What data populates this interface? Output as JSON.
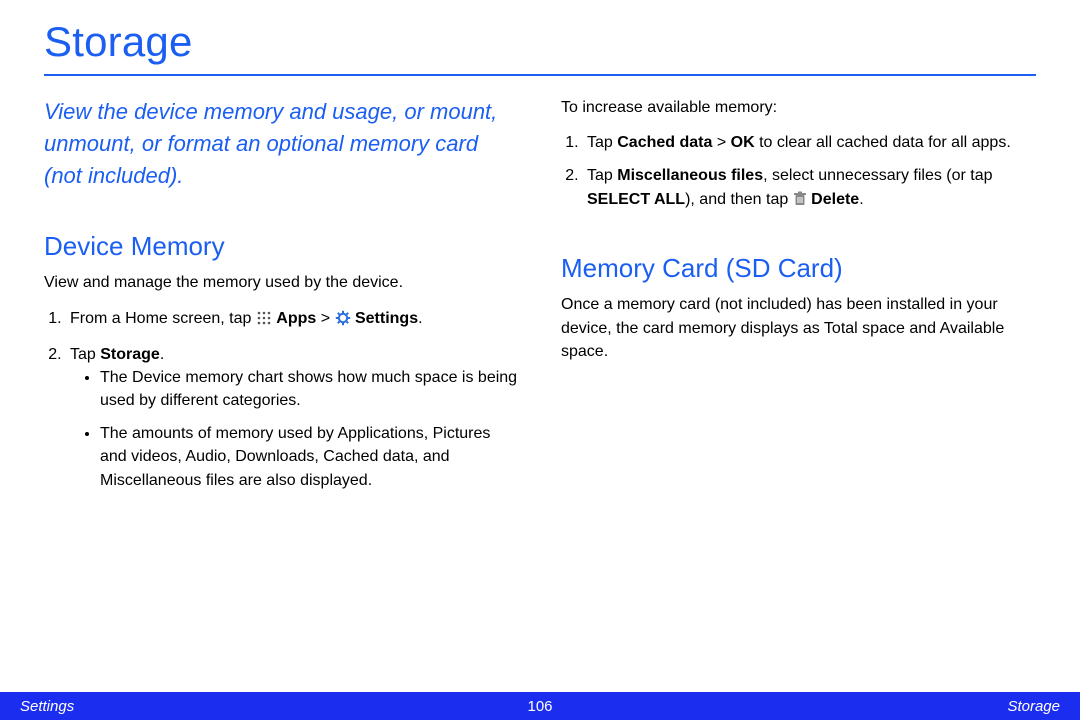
{
  "title": "Storage",
  "intro": "View the device memory and usage, or mount, unmount, or format an optional memory card (not included).",
  "left": {
    "heading": "Device Memory",
    "desc": "View and manage the memory used by the device.",
    "step1_a": "From a Home screen, tap ",
    "step1_apps": "Apps",
    "step1_gt": " > ",
    "step1_settings": " Settings",
    "step1_dot": ".",
    "step2_a": "Tap ",
    "step2_b": "Storage",
    "step2_dot": ".",
    "bul1": "The Device memory chart shows how much space is being used by different categories.",
    "bul2": "The amounts of memory used by Applications, Pictures and videos, Audio, Downloads, Cached data, and Miscellaneous files are also displayed."
  },
  "right": {
    "lead": "To increase available memory:",
    "s1_a": "Tap ",
    "s1_b": "Cached data",
    "s1_gt": " > ",
    "s1_ok": "OK",
    "s1_c": " to clear all cached data for all apps.",
    "s2_a": "Tap ",
    "s2_b": "Miscellaneous files",
    "s2_c": ", select unnecessary files (or tap ",
    "s2_d": "SELECT ALL",
    "s2_e": "), and then tap ",
    "s2_del": " Delete",
    "s2_dot": ".",
    "heading": "Memory Card (SD Card)",
    "desc": "Once a memory card (not included) has been installed in your device, the card memory displays as Total space and Available space."
  },
  "footer": {
    "left": "Settings",
    "page": "106",
    "right": "Storage"
  }
}
